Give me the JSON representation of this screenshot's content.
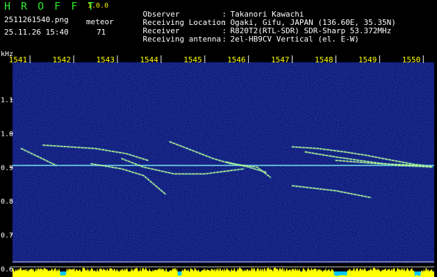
{
  "app": {
    "title": "H R O F F T",
    "version": "1.0.0",
    "file_name": "2511261540.png",
    "timestamp": "25.11.26 15:40",
    "meteor_label": "meteor",
    "meteor_count": "71"
  },
  "station": [
    {
      "key": "Observer",
      "sep": ":",
      "value": "Takanori Kawachi"
    },
    {
      "key": "Receiving Location",
      "sep": ":",
      "value": "Ogaki, Gifu, JAPAN (136.60E, 35.35N)"
    },
    {
      "key": "Receiver",
      "sep": ":",
      "value": "R820T2(RTL-SDR) SDR-Sharp 53.372MHz"
    },
    {
      "key": "Receiving antenna",
      "sep": ":",
      "value": "2el-HB9CV Vertical (el. E-W)"
    }
  ],
  "colors": {
    "background": "#000000",
    "title": "#2ee82e",
    "version": "#f0f000",
    "text": "#ffffff",
    "x_tick_labels": "#ffff00",
    "spectrum_base": "#0a1470",
    "noise_strip": "#ffff00",
    "noise_base": "#00c8ff"
  },
  "spectrogram": {
    "y_unit": "kHz",
    "y_ticks": [
      "1.1",
      "1.0",
      "0.9",
      "0.8",
      "0.7",
      "0.6"
    ],
    "y_values": [
      1.1,
      1.0,
      0.9,
      0.8,
      0.7,
      0.6
    ],
    "y_range": [
      0.575,
      1.21
    ],
    "x_ticks": [
      "1541",
      "1542",
      "1543",
      "1544",
      "1545",
      "1546",
      "1547",
      "1548",
      "1549",
      "1550"
    ],
    "x_values": [
      1541,
      1542,
      1543,
      1544,
      1545,
      1546,
      1547,
      1548,
      1549,
      1550
    ],
    "x_range": [
      1540.6,
      1550.25
    ],
    "carrier_khz": 0.905,
    "reference_lines_khz": [
      0.62,
      0.605
    ],
    "echoes": [
      {
        "x": [
          1540.8,
          1541.6
        ],
        "khz": [
          0.955,
          0.905
        ]
      },
      {
        "x": [
          1541.3,
          1542.5,
          1543.2,
          1543.7
        ],
        "khz": [
          0.965,
          0.955,
          0.94,
          0.92
        ]
      },
      {
        "x": [
          1542.4,
          1543.1,
          1543.6,
          1544.1
        ],
        "khz": [
          0.91,
          0.895,
          0.875,
          0.82
        ]
      },
      {
        "x": [
          1543.1,
          1543.6,
          1544.3,
          1545.0,
          1545.9
        ],
        "khz": [
          0.925,
          0.9,
          0.88,
          0.88,
          0.895
        ]
      },
      {
        "x": [
          1544.2,
          1544.7,
          1545.2,
          1545.6,
          1546.2,
          1546.5
        ],
        "khz": [
          0.975,
          0.95,
          0.925,
          0.91,
          0.9,
          0.87
        ]
      },
      {
        "x": [
          1545.5,
          1546.0,
          1546.4
        ],
        "khz": [
          0.915,
          0.9,
          0.885
        ]
      },
      {
        "x": [
          1547.0,
          1548.0,
          1548.8
        ],
        "khz": [
          0.845,
          0.83,
          0.81
        ]
      },
      {
        "x": [
          1547.0,
          1547.6,
          1548.2,
          1548.7,
          1549.3,
          1549.8,
          1550.2
        ],
        "khz": [
          0.96,
          0.955,
          0.945,
          0.935,
          0.92,
          0.908,
          0.902
        ]
      },
      {
        "x": [
          1547.3,
          1548.0,
          1548.8,
          1549.4,
          1550.2
        ],
        "khz": [
          0.945,
          0.93,
          0.915,
          0.905,
          0.9
        ]
      },
      {
        "x": [
          1548.0,
          1549.0,
          1550.0
        ],
        "khz": [
          0.92,
          0.91,
          0.905
        ]
      }
    ]
  }
}
